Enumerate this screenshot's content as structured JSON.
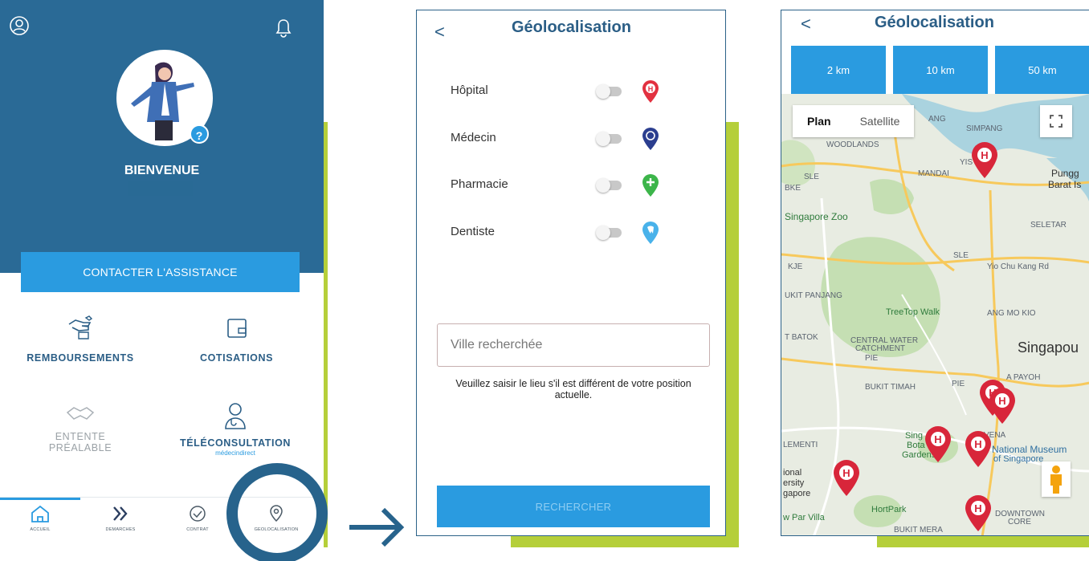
{
  "screen1": {
    "welcome": "BIENVENUE",
    "contact_button": "CONTACTER L'ASSISTANCE",
    "tiles": {
      "remboursements": "REMBOURSEMENTS",
      "cotisations": "COTISATIONS",
      "entente_line1": "ENTENTE",
      "entente_line2": "PRÉALABLE",
      "teleconsultation": "TÉLÉCONSULTATION",
      "brand": "médecindirect"
    },
    "nav": {
      "accueil": "ACCUEIL",
      "demarches": "DEMARCHES",
      "contrat": "CONTRAT",
      "geolocalisation": "GEOLOCALISATION"
    }
  },
  "screen2": {
    "back": "<",
    "title": "Géolocalisation",
    "filters": [
      {
        "label": "Hôpital",
        "color": "#e23140",
        "glyph": "H"
      },
      {
        "label": "Médecin",
        "color": "#2b3e8f",
        "glyph": "✚"
      },
      {
        "label": "Pharmacie",
        "color": "#3cb54a",
        "glyph": "+"
      },
      {
        "label": "Dentiste",
        "color": "#49b2ea",
        "glyph": "D"
      }
    ],
    "city_placeholder": "Ville recherchée",
    "help_text": "Veuillez saisir le lieu s'il est différent de votre position actuelle.",
    "search_button": "RECHERCHER"
  },
  "screen3": {
    "back": "<",
    "title": "Géolocalisation",
    "distances": [
      "2 km",
      "10 km",
      "50 km"
    ],
    "map_type": {
      "plan": "Plan",
      "satellite": "Satellite"
    },
    "map_labels": {
      "simpang": "SIMPANG",
      "woodlands": "WOODLANDS",
      "mandai": "MANDAI",
      "yishun": "YIS",
      "punggol": "Pungg",
      "barat": "Barat Is",
      "sle": "SLE",
      "bke": "BKE",
      "zoo": "Singapore Zoo",
      "seletar": "SELETAR",
      "kje": "KJE",
      "sle2": "SLE",
      "yiochukang": "Yio Chu Kang Rd",
      "bukitpanjang": "UKIT PANJANG",
      "treetop": "TreeTop Walk",
      "angmokio": "ANG MO KIO",
      "batok": "T BATOK",
      "central": "CENTRAL WATER",
      "catchment": "CATCHMENT",
      "pie": "PIE",
      "singapore": "Singapou",
      "payoh": "A PAYOH",
      "timah": "BUKIT TIMAH",
      "pie2": "PIE",
      "lementi": "LEMENTI",
      "botanic1": "Sing",
      "botanic2": "Bota",
      "botanic3": "Gardens",
      "vena": "VENA",
      "museum1": "National Museum",
      "museum2": "of Singapore",
      "ional": "ional",
      "ersity": "ersity",
      "gapore": "gapore",
      "parvilla": "w Par Villa",
      "hortpark": "HortPark",
      "downtown1": "DOWNTOWN",
      "downtown2": "CORE",
      "bukitmera": "BUKIT MERA",
      "ang": "ANG"
    }
  },
  "colors": {
    "primary_dark": "#2a6a96",
    "primary": "#2a9be0",
    "accent": "#b5cf3a",
    "title": "#2b5e86",
    "hospital": "#e23140"
  }
}
